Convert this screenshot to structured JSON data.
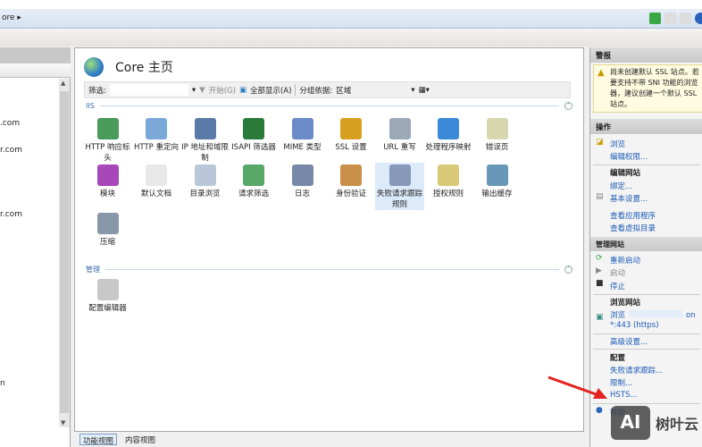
{
  "address": {
    "crumb": "ore ▸"
  },
  "tree": {
    "nodes": [
      ".com",
      "r.com",
      "r.com",
      "n"
    ]
  },
  "center": {
    "title": "Core 主页",
    "filter": {
      "label": "筛选:",
      "value": "",
      "start": "开始(G)",
      "show_all": "全部显示(A)",
      "group_label": "分组依据:",
      "group_value": "区域"
    },
    "groups": [
      {
        "name": "IIS",
        "features": [
          "HTTP 响应标头",
          "HTTP 重定向",
          "IP 地址和域限制",
          "ISAPI 筛选器",
          "MIME 类型",
          "SSL 设置",
          "URL 重写",
          "处理程序映射",
          "错误页",
          "模块",
          "默认文档",
          "目录浏览",
          "请求筛选",
          "日志",
          "身份验证",
          "失败请求跟踪规则",
          "授权规则",
          "输出缓存",
          "压缩"
        ]
      },
      {
        "name": "管理",
        "features": [
          "配置编辑器"
        ]
      }
    ],
    "selected": "失败请求跟踪规则",
    "views": [
      "功能视图",
      "内容视图"
    ]
  },
  "right": {
    "alerts_title": "警报",
    "alert": [
      "尚未创建默认 SSL 站点。若",
      "要支持不带 SNI 功能的浏览",
      "器，建议创建一个默认 SSL",
      "站点。"
    ],
    "actions_title": "操作",
    "browse": "浏览",
    "edit_perms": "编辑权限...",
    "edit_site": "编辑网站",
    "bindings": "绑定...",
    "basic": "基本设置...",
    "view_apps": "查看应用程序",
    "view_vdirs": "查看虚拟目录",
    "manage_site": "管理网站",
    "restart": "重新启动",
    "start": "启动",
    "stop": "停止",
    "browse_site": "浏览网站",
    "browse_link": "浏览",
    "browse_link_suffix": "on",
    "https": "*:443 (https)",
    "advanced": "高级设置...",
    "config": "配置",
    "frt": "失败请求跟踪...",
    "limits": "限制...",
    "hsts": "HSTS...",
    "help": "帮助"
  },
  "watermark": {
    "logo": "AI",
    "text": "树叶云"
  }
}
